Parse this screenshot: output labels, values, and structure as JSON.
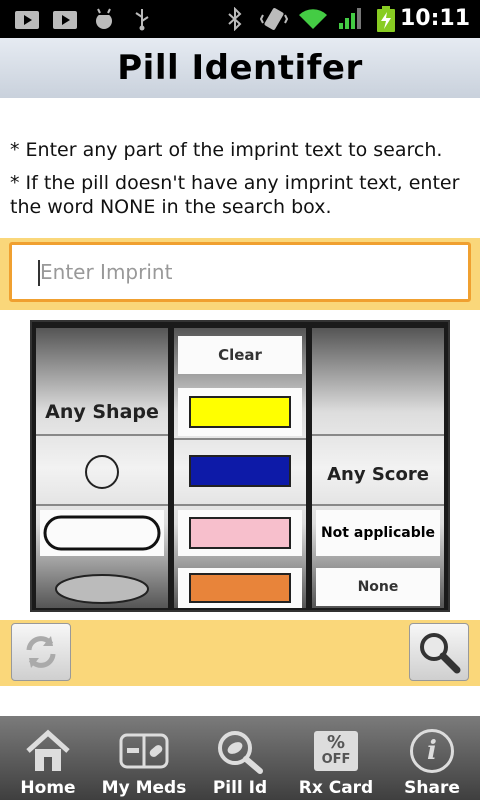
{
  "status_bar": {
    "time": "10:11",
    "icons": [
      "play-store-icon",
      "play-store-icon",
      "android-debug-icon",
      "usb-icon",
      "bluetooth-icon",
      "vibrate-icon",
      "wifi-icon",
      "signal-icon",
      "battery-charging-icon"
    ]
  },
  "header": {
    "title": "Pill Identifer"
  },
  "instructions": {
    "line1": "* Enter any part of the imprint text to search.",
    "line2": "* If the pill doesn't have any imprint text, enter the word NONE in the search box."
  },
  "search": {
    "value": "",
    "placeholder": "Enter Imprint"
  },
  "picker": {
    "shape": {
      "selected": "Any Shape"
    },
    "color": {
      "clear_label": "Clear",
      "swatches": [
        "#ffff00",
        "#0d1aa8",
        "#f7bfcc",
        "#e8843a"
      ]
    },
    "score": {
      "selected": "Any Score",
      "option_not_applicable": "Not applicable",
      "option_none": "None"
    }
  },
  "actions": {
    "reset_icon": "refresh-icon",
    "search_icon": "magnifier-icon"
  },
  "nav": {
    "home": "Home",
    "my_meds": "My Meds",
    "pill_id": "Pill Id",
    "rx_card": "Rx Card",
    "share": "Share",
    "rx_card_icon_text": "%",
    "rx_card_icon_sub": "OFF",
    "share_icon_text": "i"
  }
}
